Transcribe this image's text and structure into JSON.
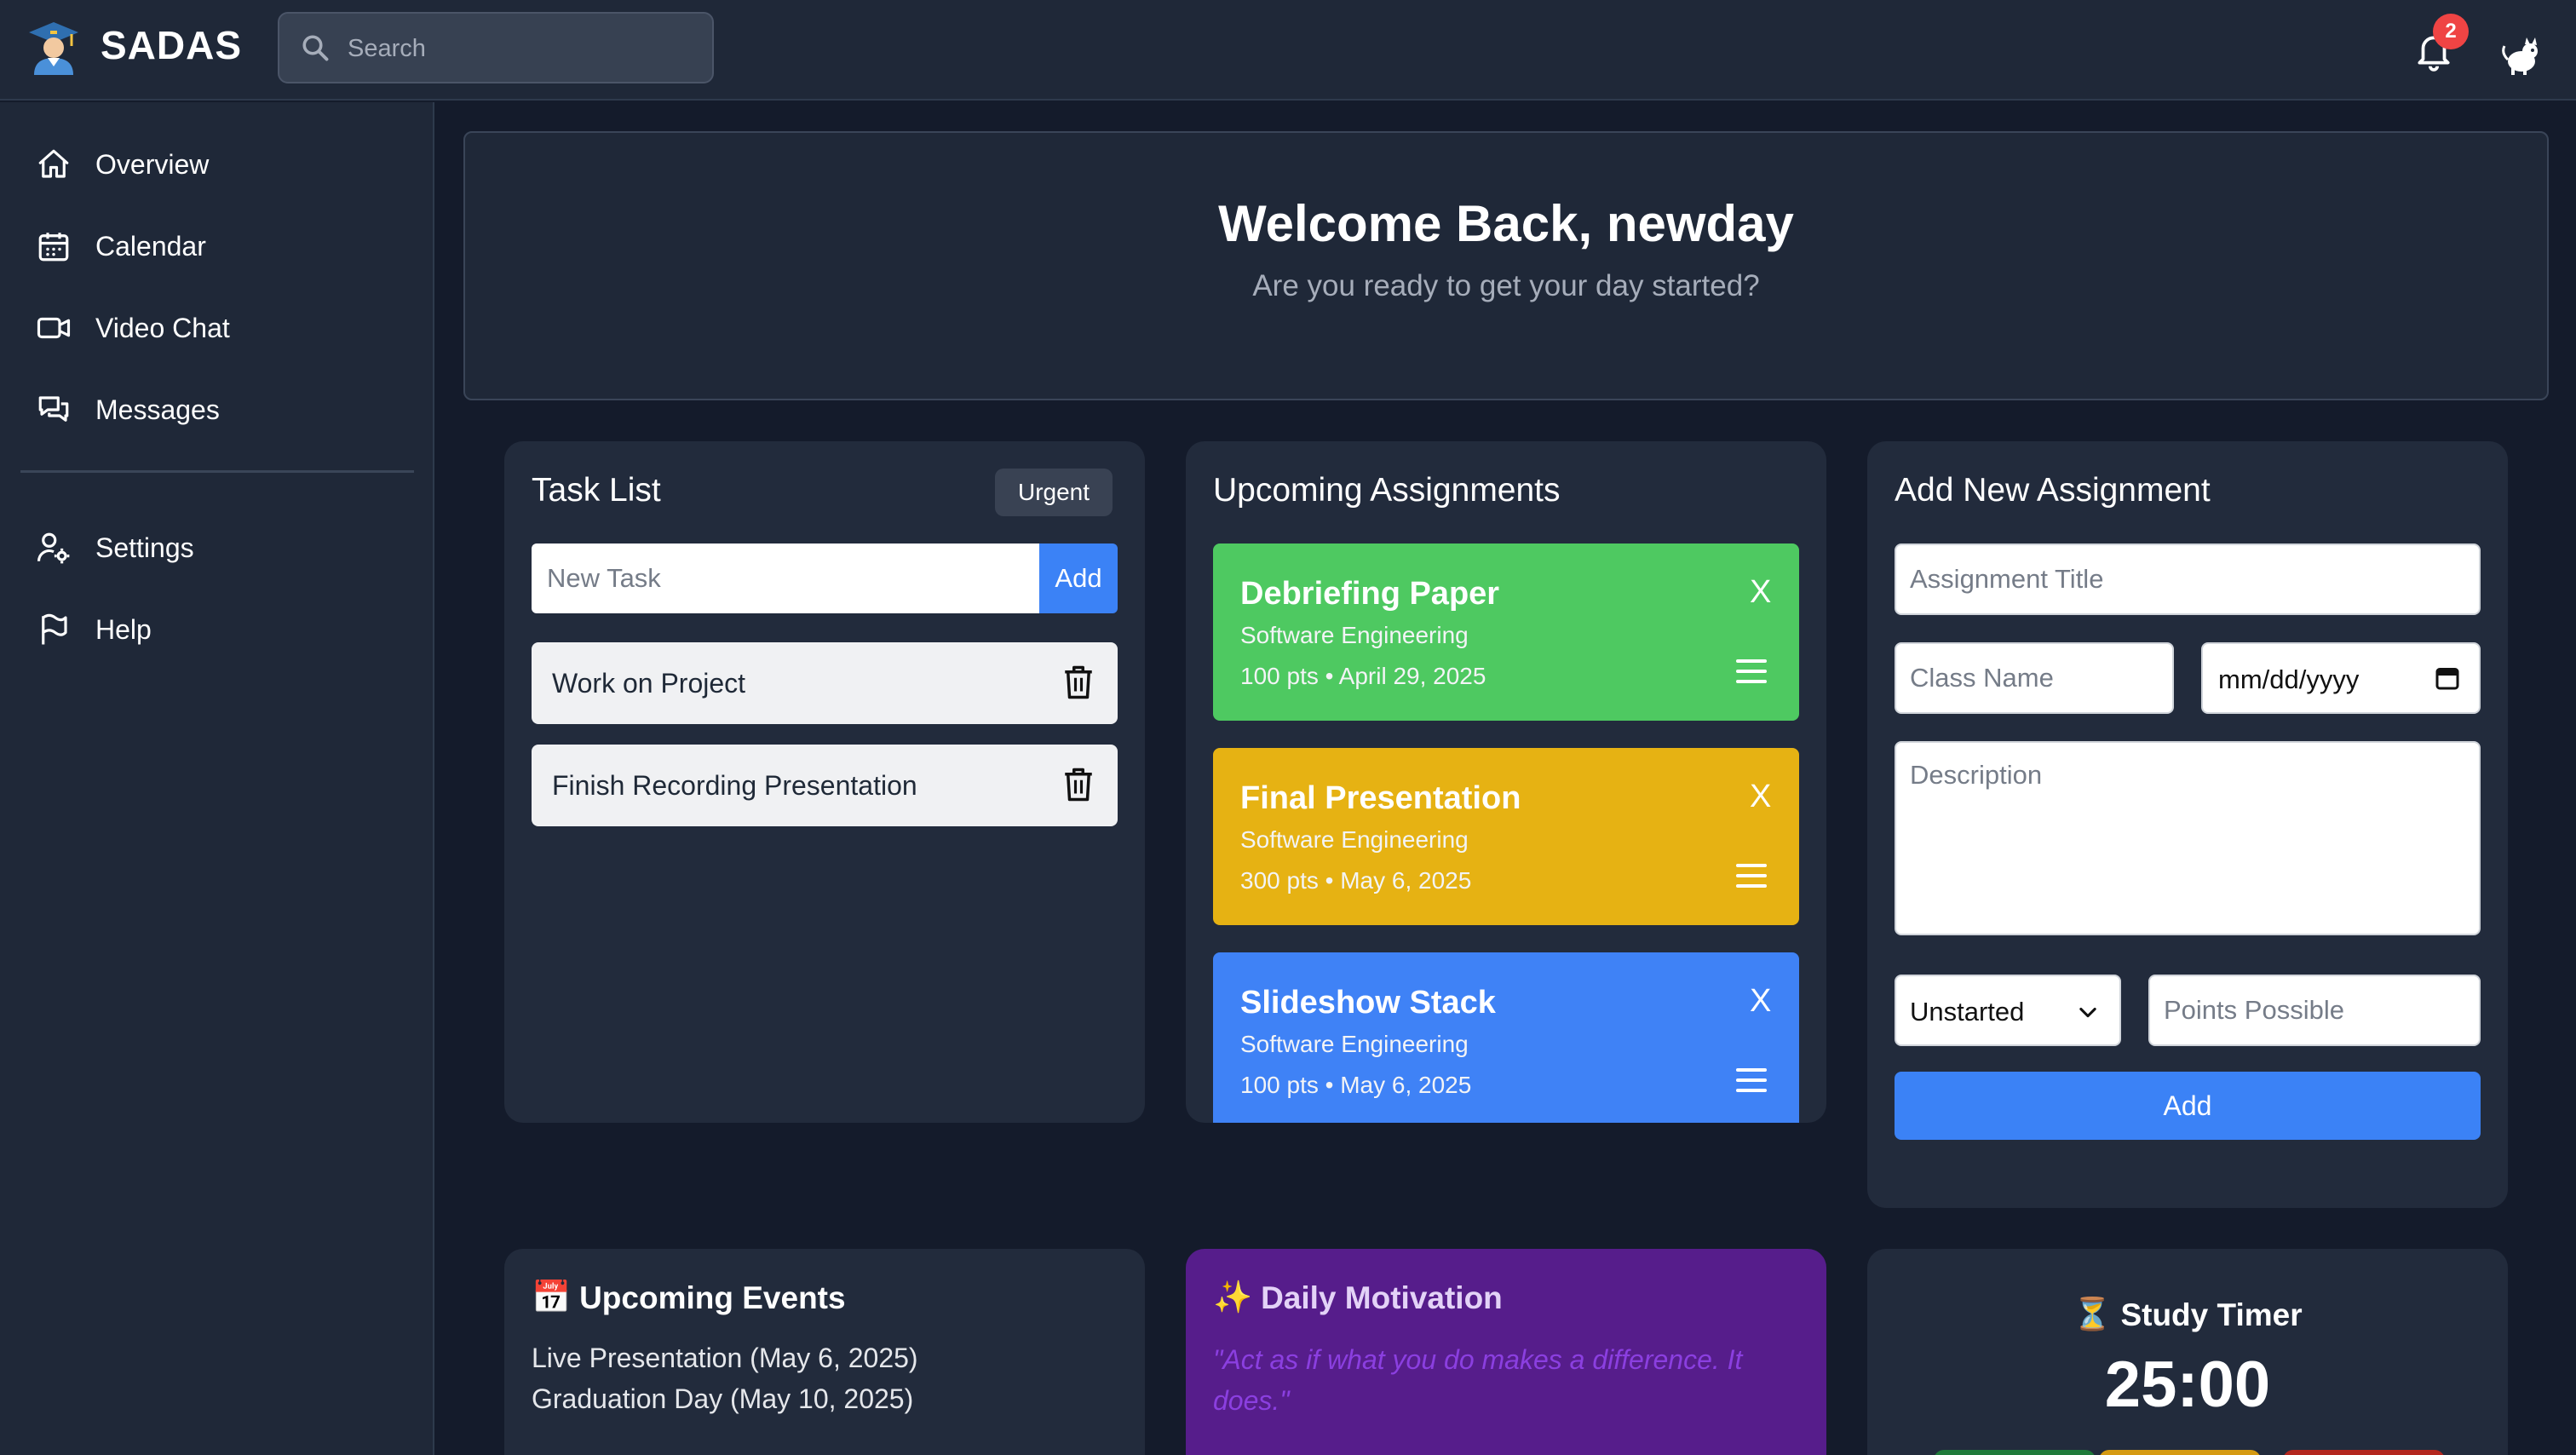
{
  "header": {
    "brand": "SADAS",
    "search_placeholder": "Search",
    "notification_count": "2"
  },
  "sidebar": {
    "items": [
      {
        "label": "Overview",
        "icon": "home-icon"
      },
      {
        "label": "Calendar",
        "icon": "calendar-icon"
      },
      {
        "label": "Video Chat",
        "icon": "video-icon"
      },
      {
        "label": "Messages",
        "icon": "chat-icon"
      }
    ],
    "secondary": [
      {
        "label": "Settings",
        "icon": "user-settings-icon"
      },
      {
        "label": "Help",
        "icon": "flag-icon"
      }
    ]
  },
  "welcome": {
    "title": "Welcome Back, newday",
    "subtitle": "Are you ready to get your day started?"
  },
  "tasks": {
    "title": "Task List",
    "urgent_label": "Urgent",
    "input_placeholder": "New Task",
    "add_label": "Add",
    "items": [
      "Work on Project",
      "Finish Recording Presentation"
    ]
  },
  "assignments": {
    "title": "Upcoming Assignments",
    "items": [
      {
        "title": "Debriefing Paper",
        "class": "Software Engineering",
        "meta": "100 pts  •  April 29, 2025",
        "color": "#4ec961",
        "close": "X"
      },
      {
        "title": "Final Presentation",
        "class": "Software Engineering",
        "meta": "300 pts  •  May 6, 2025",
        "color": "#e6b213",
        "close": "X"
      },
      {
        "title": "Slideshow Stack",
        "class": "Software Engineering",
        "meta": "100 pts  •  May 6, 2025",
        "color": "#3f82f6",
        "close": "X"
      }
    ]
  },
  "new_assignment": {
    "title": "Add New Assignment",
    "title_placeholder": "Assignment Title",
    "class_placeholder": "Class Name",
    "date_placeholder": "mm/dd/yyyy",
    "description_placeholder": "Description",
    "status_value": "Unstarted",
    "points_placeholder": "Points Possible",
    "add_label": "Add"
  },
  "events": {
    "title": "Upcoming Events",
    "emoji": "📅",
    "items": [
      "Live Presentation (May 6, 2025)",
      "Graduation Day (May 10, 2025)"
    ]
  },
  "motivation": {
    "title": "Daily Motivation",
    "emoji": "✨",
    "quote": "\"Act as if what you do makes a difference. It does.\""
  },
  "timer": {
    "title": "Study Timer",
    "emoji": "⏳",
    "value": "25:00",
    "button_colors": [
      "#1f7a3a",
      "#d59a12",
      "#b3261e"
    ]
  },
  "colors": {
    "accent": "#3b82f6",
    "bg": "#141b2b",
    "panel": "#222b3c",
    "motivation_bg": "#561d8b"
  }
}
